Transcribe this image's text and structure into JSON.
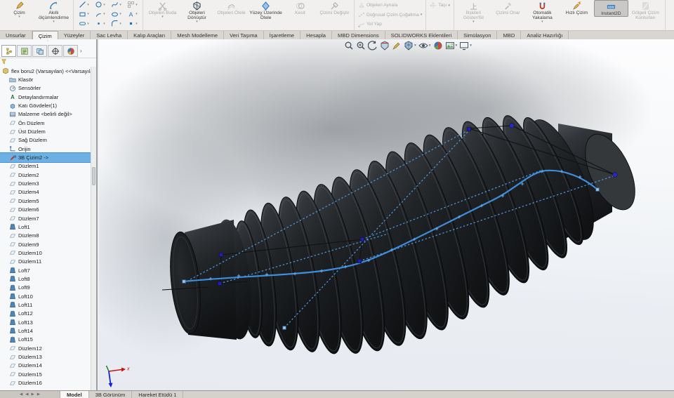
{
  "ribbon": {
    "groups": [
      {
        "name": "sketch-insert",
        "type": "big",
        "buttons": [
          {
            "label": "Çizim",
            "icon": "pencil",
            "enabled": true,
            "caret": true
          },
          {
            "label": "Akıllı ölçümlendirme",
            "icon": "smart-dimension",
            "enabled": true,
            "caret": true
          }
        ]
      },
      {
        "name": "sketch-entities",
        "type": "grid",
        "cells": [
          {
            "icon": "line"
          },
          {
            "icon": "circle"
          },
          {
            "icon": "spline"
          },
          {
            "icon": "pattern"
          },
          {
            "icon": "rect"
          },
          {
            "icon": "arc"
          },
          {
            "icon": "ellipse"
          },
          {
            "icon": "text"
          },
          {
            "icon": "slot"
          },
          {
            "icon": "point"
          },
          {
            "icon": "fillet"
          },
          {
            "icon": "dot"
          }
        ]
      },
      {
        "name": "sketch-tools",
        "type": "big",
        "buttons": [
          {
            "label": "Objeleri Buda",
            "icon": "trim",
            "enabled": false,
            "caret": true
          },
          {
            "label": "Objeleri Dönüştür",
            "icon": "convert",
            "enabled": true,
            "caret": true
          },
          {
            "label": "Objeleri Ötele",
            "icon": "offset",
            "enabled": false
          },
          {
            "label": "Yüzey Üzerinde Ötele",
            "icon": "offset-surface",
            "enabled": true
          },
          {
            "label": "Kesit",
            "icon": "intersect",
            "enabled": false
          },
          {
            "label": "Çizimi Değiştir",
            "icon": "modify",
            "enabled": false
          }
        ]
      },
      {
        "name": "pattern-tools",
        "type": "stack",
        "buttons": [
          {
            "label": "Objeleri Aynala",
            "icon": "mirror",
            "enabled": false
          },
          {
            "label": "Doğrusal Çizim Çoğaltma",
            "icon": "linear-pattern",
            "enabled": false,
            "caret": true
          },
          {
            "label": "Yol Yap",
            "icon": "make-path",
            "enabled": false
          }
        ]
      },
      {
        "name": "move-tools",
        "type": "stack",
        "buttons": [
          {
            "label": "Taşı",
            "icon": "move",
            "enabled": false,
            "caret": true
          }
        ]
      },
      {
        "name": "relations-tools",
        "type": "big",
        "buttons": [
          {
            "label": "İlişkileri Göster/Sil",
            "icon": "relations",
            "enabled": false,
            "caret": true
          },
          {
            "label": "Çizimi Onar",
            "icon": "repair",
            "enabled": false
          },
          {
            "label": "Otomatik Yakalama",
            "icon": "snap",
            "enabled": true,
            "caret": true
          },
          {
            "label": "Hızlı Çizim",
            "icon": "quick-sketch",
            "enabled": true
          },
          {
            "label": "Instant2D",
            "icon": "instant2d",
            "enabled": true,
            "pressed": true
          },
          {
            "label": "Gölgeli Çizim Konturları",
            "icon": "shaded-contours",
            "enabled": false
          }
        ]
      }
    ]
  },
  "ribbon_tabs": {
    "active": "Çizim",
    "items": [
      "Unsurlar",
      "Çizim",
      "Yüzeyler",
      "Sac Levha",
      "Kalıp Araçları",
      "Mesh Modelleme",
      "Veri Taşıma",
      "İşaretleme",
      "Hesapla",
      "MBD Dimensions",
      "SOLIDWORKS Eklentileri",
      "Simülasyon",
      "MBD",
      "Analiz Hazırlığı"
    ]
  },
  "feature_panel": {
    "tabs": [
      "featuremanager-tree",
      "propertymanager",
      "configurationmanager",
      "dimxpertmanager",
      "displaymanager"
    ],
    "expand_glyph": "›",
    "splitter_glyph": "◦",
    "tree": [
      {
        "label": "flex boru2 (Varsayılan) <<Varsayıla",
        "icon": "part",
        "root": true
      },
      {
        "label": "Klasör",
        "icon": "folder"
      },
      {
        "label": "Sensörler",
        "icon": "sensors"
      },
      {
        "label": "Detaylandırmalar",
        "icon": "annotations"
      },
      {
        "label": "Katı Gövdeler(1)",
        "icon": "bodies"
      },
      {
        "label": "Malzeme <belirli değil>",
        "icon": "material"
      },
      {
        "label": "Ön Düzlem",
        "icon": "plane"
      },
      {
        "label": "Üst Düzlem",
        "icon": "plane"
      },
      {
        "label": "Sağ Düzlem",
        "icon": "plane"
      },
      {
        "label": "Orijin",
        "icon": "origin"
      },
      {
        "label": "3B Çizim2 ->",
        "icon": "sketch3d",
        "selected": true
      },
      {
        "label": "Düzlem1",
        "icon": "plane"
      },
      {
        "label": "Düzlem2",
        "icon": "plane"
      },
      {
        "label": "Düzlem3",
        "icon": "plane"
      },
      {
        "label": "Düzlem4",
        "icon": "plane"
      },
      {
        "label": "Düzlem5",
        "icon": "plane"
      },
      {
        "label": "Düzlem6",
        "icon": "plane"
      },
      {
        "label": "Düzlem7",
        "icon": "plane"
      },
      {
        "label": "Loft1",
        "icon": "loft"
      },
      {
        "label": "Düzlem8",
        "icon": "plane"
      },
      {
        "label": "Düzlem9",
        "icon": "plane"
      },
      {
        "label": "Düzlem10",
        "icon": "plane"
      },
      {
        "label": "Düzlem11",
        "icon": "plane"
      },
      {
        "label": "Loft7",
        "icon": "loft"
      },
      {
        "label": "Loft8",
        "icon": "loft"
      },
      {
        "label": "Loft9",
        "icon": "loft"
      },
      {
        "label": "Loft10",
        "icon": "loft"
      },
      {
        "label": "Loft11",
        "icon": "loft"
      },
      {
        "label": "Loft12",
        "icon": "loft"
      },
      {
        "label": "Loft13",
        "icon": "loft"
      },
      {
        "label": "Loft14",
        "icon": "loft"
      },
      {
        "label": "Loft15",
        "icon": "loft"
      },
      {
        "label": "Düzlem12",
        "icon": "plane"
      },
      {
        "label": "Düzlem13",
        "icon": "plane"
      },
      {
        "label": "Düzlem14",
        "icon": "plane"
      },
      {
        "label": "Düzlem15",
        "icon": "plane"
      },
      {
        "label": "Düzlem16",
        "icon": "plane"
      }
    ]
  },
  "headsup": {
    "items": [
      {
        "name": "zoom-to-fit",
        "caret": false
      },
      {
        "name": "zoom-to-area",
        "caret": false
      },
      {
        "name": "previous-view",
        "caret": false
      },
      {
        "name": "section-view",
        "caret": false
      },
      {
        "name": "sketch-visibility",
        "caret": false
      },
      {
        "name": "display-style",
        "caret": true
      },
      {
        "name": "hide-show-items",
        "caret": true
      },
      {
        "name": "edit-appearance",
        "caret": false
      },
      {
        "name": "apply-scene",
        "caret": true
      },
      {
        "name": "view-settings",
        "caret": true
      }
    ]
  },
  "viewport": {
    "triad_x_label": "x"
  },
  "bottom_tabs": {
    "active": "Model",
    "items": [
      "Model",
      "3B Görünüm",
      "Hareket Etüdü 1"
    ]
  },
  "colors": {
    "selection": "#6cb0e4",
    "spline": "#3e8ede",
    "construction": "#4f97dd",
    "model_dark": "#1d1f22",
    "accent": "#1f6fb5"
  }
}
